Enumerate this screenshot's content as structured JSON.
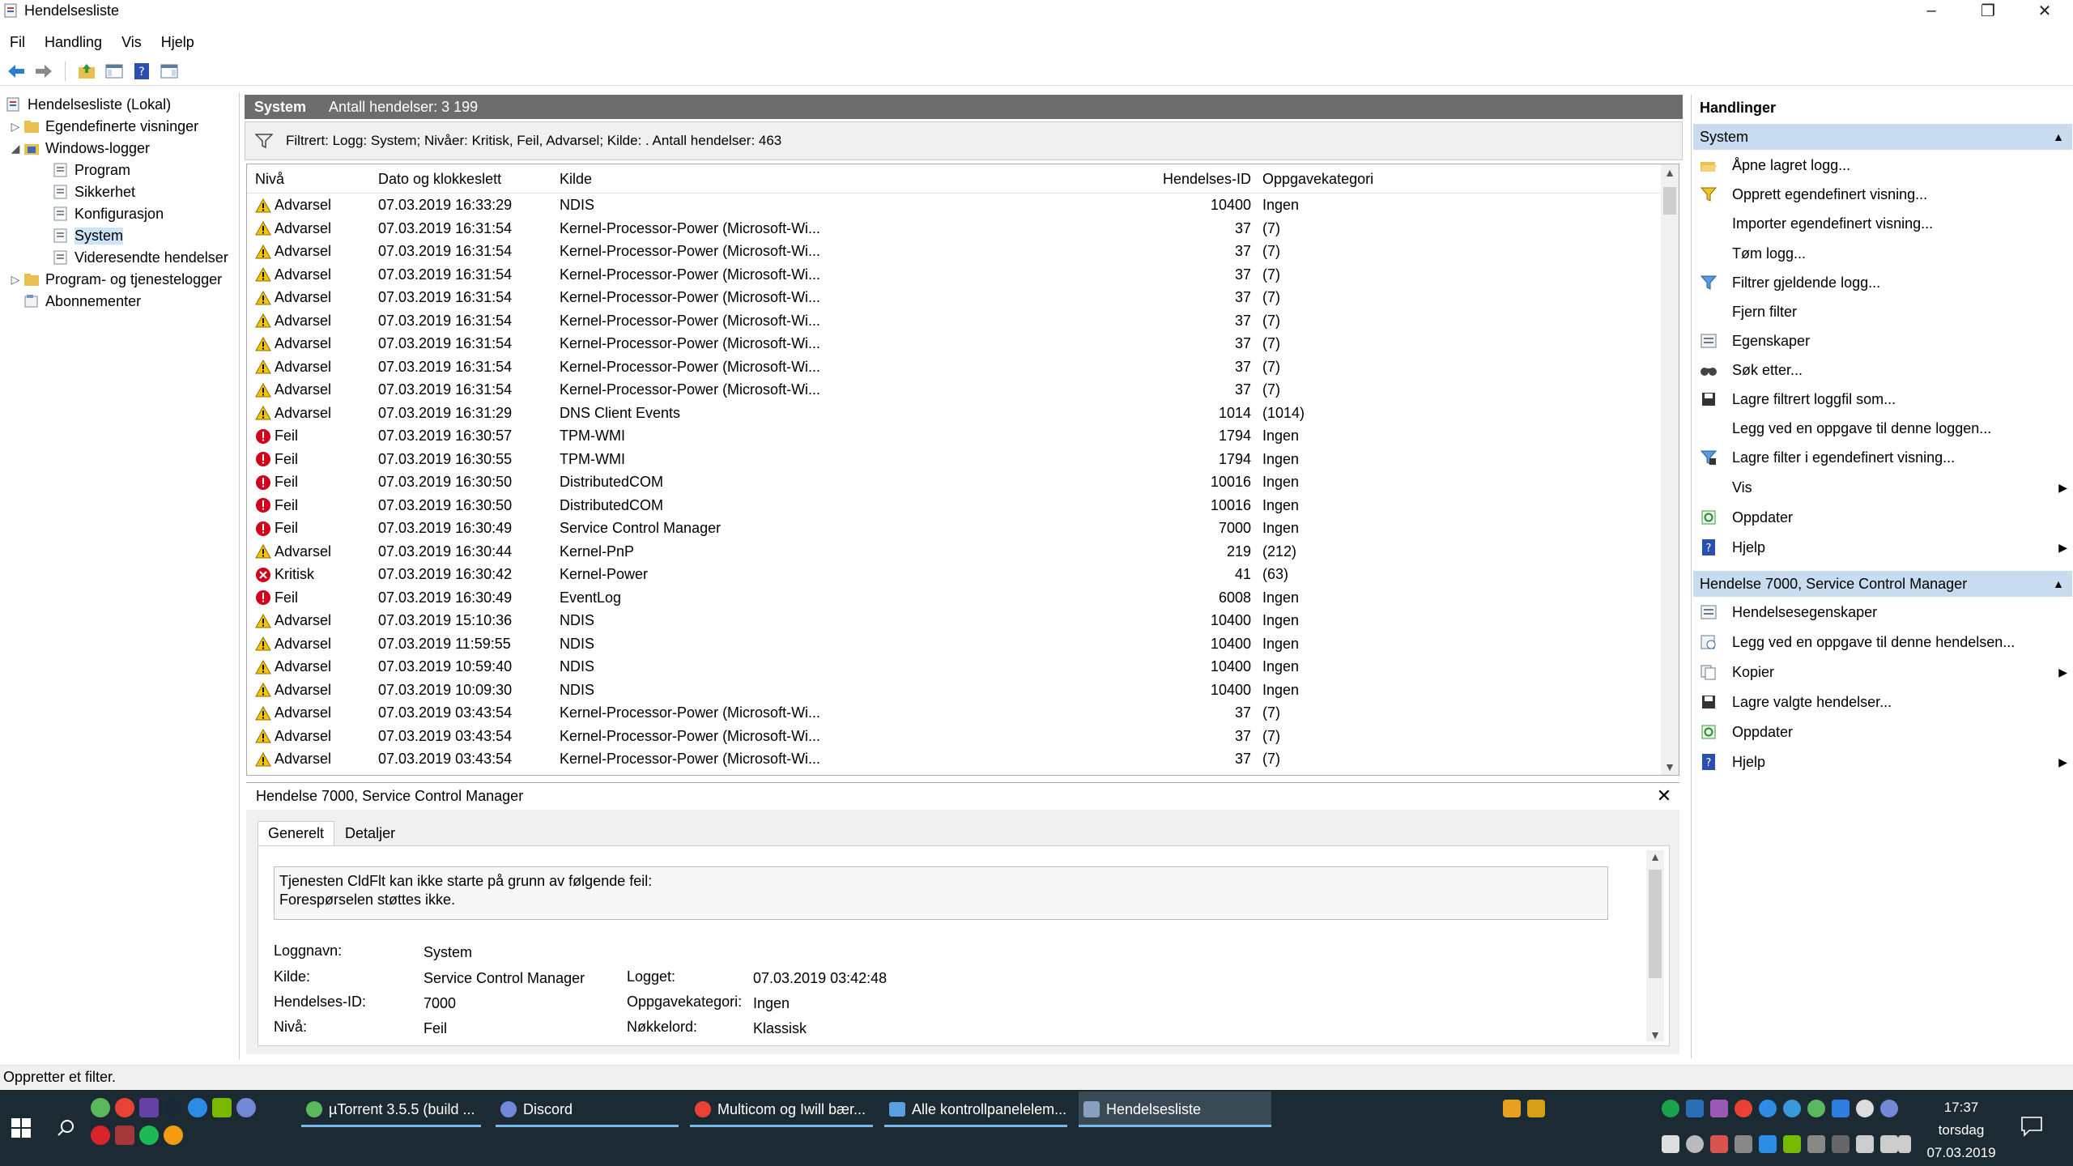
{
  "window": {
    "title": "Hendelsesliste"
  },
  "menu": [
    "Fil",
    "Handling",
    "Vis",
    "Hjelp"
  ],
  "tree": {
    "root": "Hendelsesliste (Lokal)",
    "custom_views": "Egendefinerte visninger",
    "windows_logs": "Windows-logger",
    "logs": [
      "Program",
      "Sikkerhet",
      "Konfigurasjon",
      "System",
      "Videresendte hendelser"
    ],
    "apps_services": "Program- og tjenestelogger",
    "subscriptions": "Abonnementer"
  },
  "log_header": {
    "name": "System",
    "count_text": "Antall hendelser: 3 199"
  },
  "filter_text": "Filtrert: Logg: System; Nivåer: Kritisk, Feil, Advarsel; Kilde: . Antall hendelser: 463",
  "columns": {
    "level": "Nivå",
    "date": "Dato og klokkeslett",
    "source": "Kilde",
    "id": "Hendelses-ID",
    "category": "Oppgavekategori"
  },
  "events": [
    {
      "level": "Advarsel",
      "date": "07.03.2019 16:33:29",
      "source": "NDIS",
      "id": "10400",
      "category": "Ingen"
    },
    {
      "level": "Advarsel",
      "date": "07.03.2019 16:31:54",
      "source": "Kernel-Processor-Power (Microsoft-Wi...",
      "id": "37",
      "category": "(7)"
    },
    {
      "level": "Advarsel",
      "date": "07.03.2019 16:31:54",
      "source": "Kernel-Processor-Power (Microsoft-Wi...",
      "id": "37",
      "category": "(7)"
    },
    {
      "level": "Advarsel",
      "date": "07.03.2019 16:31:54",
      "source": "Kernel-Processor-Power (Microsoft-Wi...",
      "id": "37",
      "category": "(7)"
    },
    {
      "level": "Advarsel",
      "date": "07.03.2019 16:31:54",
      "source": "Kernel-Processor-Power (Microsoft-Wi...",
      "id": "37",
      "category": "(7)"
    },
    {
      "level": "Advarsel",
      "date": "07.03.2019 16:31:54",
      "source": "Kernel-Processor-Power (Microsoft-Wi...",
      "id": "37",
      "category": "(7)"
    },
    {
      "level": "Advarsel",
      "date": "07.03.2019 16:31:54",
      "source": "Kernel-Processor-Power (Microsoft-Wi...",
      "id": "37",
      "category": "(7)"
    },
    {
      "level": "Advarsel",
      "date": "07.03.2019 16:31:54",
      "source": "Kernel-Processor-Power (Microsoft-Wi...",
      "id": "37",
      "category": "(7)"
    },
    {
      "level": "Advarsel",
      "date": "07.03.2019 16:31:54",
      "source": "Kernel-Processor-Power (Microsoft-Wi...",
      "id": "37",
      "category": "(7)"
    },
    {
      "level": "Advarsel",
      "date": "07.03.2019 16:31:29",
      "source": "DNS Client Events",
      "id": "1014",
      "category": "(1014)"
    },
    {
      "level": "Feil",
      "date": "07.03.2019 16:30:57",
      "source": "TPM-WMI",
      "id": "1794",
      "category": "Ingen"
    },
    {
      "level": "Feil",
      "date": "07.03.2019 16:30:55",
      "source": "TPM-WMI",
      "id": "1794",
      "category": "Ingen"
    },
    {
      "level": "Feil",
      "date": "07.03.2019 16:30:50",
      "source": "DistributedCOM",
      "id": "10016",
      "category": "Ingen"
    },
    {
      "level": "Feil",
      "date": "07.03.2019 16:30:50",
      "source": "DistributedCOM",
      "id": "10016",
      "category": "Ingen"
    },
    {
      "level": "Feil",
      "date": "07.03.2019 16:30:49",
      "source": "Service Control Manager",
      "id": "7000",
      "category": "Ingen"
    },
    {
      "level": "Advarsel",
      "date": "07.03.2019 16:30:44",
      "source": "Kernel-PnP",
      "id": "219",
      "category": "(212)"
    },
    {
      "level": "Kritisk",
      "date": "07.03.2019 16:30:42",
      "source": "Kernel-Power",
      "id": "41",
      "category": "(63)"
    },
    {
      "level": "Feil",
      "date": "07.03.2019 16:30:49",
      "source": "EventLog",
      "id": "6008",
      "category": "Ingen"
    },
    {
      "level": "Advarsel",
      "date": "07.03.2019 15:10:36",
      "source": "NDIS",
      "id": "10400",
      "category": "Ingen"
    },
    {
      "level": "Advarsel",
      "date": "07.03.2019 11:59:55",
      "source": "NDIS",
      "id": "10400",
      "category": "Ingen"
    },
    {
      "level": "Advarsel",
      "date": "07.03.2019 10:59:40",
      "source": "NDIS",
      "id": "10400",
      "category": "Ingen"
    },
    {
      "level": "Advarsel",
      "date": "07.03.2019 10:09:30",
      "source": "NDIS",
      "id": "10400",
      "category": "Ingen"
    },
    {
      "level": "Advarsel",
      "date": "07.03.2019 03:43:54",
      "source": "Kernel-Processor-Power (Microsoft-Wi...",
      "id": "37",
      "category": "(7)"
    },
    {
      "level": "Advarsel",
      "date": "07.03.2019 03:43:54",
      "source": "Kernel-Processor-Power (Microsoft-Wi...",
      "id": "37",
      "category": "(7)"
    },
    {
      "level": "Advarsel",
      "date": "07.03.2019 03:43:54",
      "source": "Kernel-Processor-Power (Microsoft-Wi...",
      "id": "37",
      "category": "(7)"
    }
  ],
  "detail": {
    "title": "Hendelse 7000, Service Control Manager",
    "tabs": [
      "Generelt",
      "Detaljer"
    ],
    "message_line1": "Tjenesten CldFlt kan ikke starte på grunn av følgende feil:",
    "message_line2": "Forespørselen støttes ikke.",
    "labels": {
      "log_name": "Loggnavn:",
      "source": "Kilde:",
      "event_id": "Hendelses-ID:",
      "level": "Nivå:",
      "logged": "Logget:",
      "task_category": "Oppgavekategori:",
      "keywords": "Nøkkelord:"
    },
    "values": {
      "log_name": "System",
      "source": "Service Control Manager",
      "event_id": "7000",
      "level": "Feil",
      "logged": "07.03.2019 03:42:48",
      "task_category": "Ingen",
      "keywords": "Klassisk"
    }
  },
  "actions": {
    "title": "Handlinger",
    "section1": "System",
    "items1": [
      "Åpne lagret logg...",
      "Opprett egendefinert visning...",
      "Importer egendefinert visning...",
      "Tøm logg...",
      "Filtrer gjeldende logg...",
      "Fjern filter",
      "Egenskaper",
      "Søk etter...",
      "Lagre filtrert loggfil som...",
      "Legg ved en oppgave til denne loggen...",
      "Lagre filter i egendefinert visning...",
      "Vis",
      "Oppdater",
      "Hjelp"
    ],
    "section2": "Hendelse 7000, Service Control Manager",
    "items2": [
      "Hendelsesegenskaper",
      "Legg ved en oppgave til denne hendelsen...",
      "Kopier",
      "Lagre valgte hendelser...",
      "Oppdater",
      "Hjelp"
    ]
  },
  "status": "Oppretter et filter.",
  "taskbar": {
    "tasks": [
      "µTorrent 3.5.5  (build ...",
      "Discord",
      "Multicom og Iwill bær...",
      "Alle kontrollpanelelem...",
      "Hendelsesliste"
    ],
    "time": "17:37",
    "day": "torsdag",
    "date": "07.03.2019"
  },
  "colors": {
    "accent": "#0078d7",
    "header_gray": "#6d6d6d",
    "section_blue": "#c9dcef",
    "warning": "#f5c400",
    "error": "#d0021b",
    "taskbar": "#1c2b33"
  }
}
